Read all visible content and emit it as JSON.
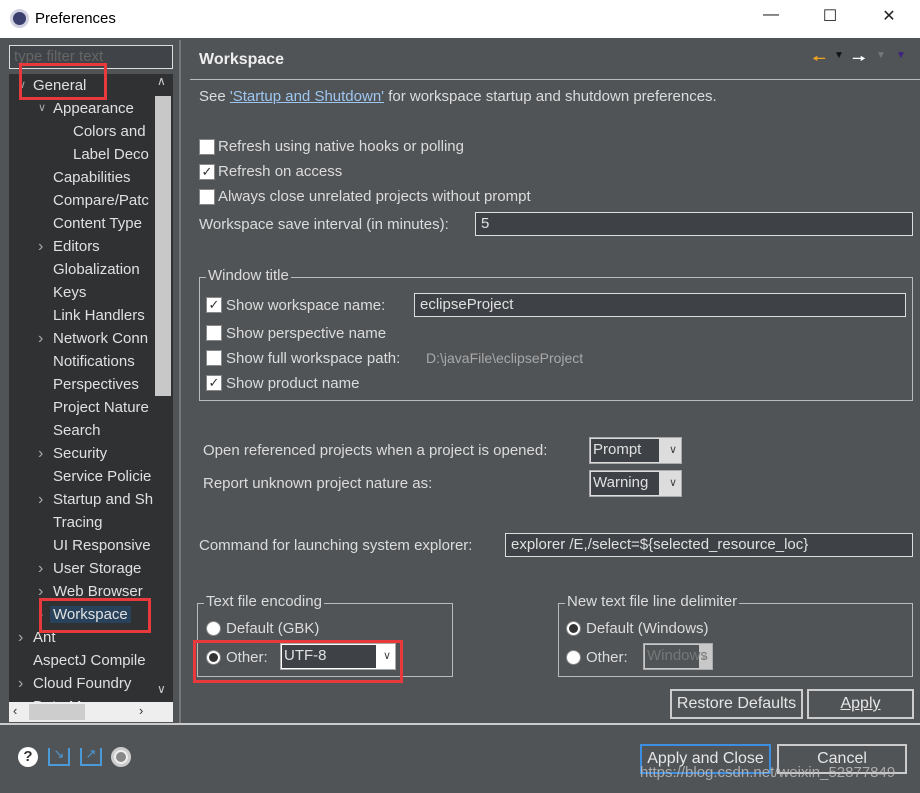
{
  "window": {
    "title": "Preferences",
    "icon": "eclipse-gear-icon",
    "controls": [
      "minimize",
      "maximize",
      "close"
    ]
  },
  "sidebar": {
    "filter_placeholder": "type filter text",
    "items": [
      {
        "label": "General",
        "level": 0,
        "expander": "expanded"
      },
      {
        "label": "Appearance",
        "level": 1,
        "expander": "expanded"
      },
      {
        "label": "Colors and",
        "level": 2
      },
      {
        "label": "Label Deco",
        "level": 2
      },
      {
        "label": "Capabilities",
        "level": 1
      },
      {
        "label": "Compare/Patc",
        "level": 1
      },
      {
        "label": "Content Type",
        "level": 1
      },
      {
        "label": "Editors",
        "level": 1,
        "expander": "collapsed"
      },
      {
        "label": "Globalization",
        "level": 1
      },
      {
        "label": "Keys",
        "level": 1
      },
      {
        "label": "Link Handlers",
        "level": 1
      },
      {
        "label": "Network Conn",
        "level": 1,
        "expander": "collapsed"
      },
      {
        "label": "Notifications",
        "level": 1
      },
      {
        "label": "Perspectives",
        "level": 1
      },
      {
        "label": "Project Nature",
        "level": 1
      },
      {
        "label": "Search",
        "level": 1
      },
      {
        "label": "Security",
        "level": 1,
        "expander": "collapsed"
      },
      {
        "label": "Service Policie",
        "level": 1
      },
      {
        "label": "Startup and Sh",
        "level": 1,
        "expander": "collapsed"
      },
      {
        "label": "Tracing",
        "level": 1
      },
      {
        "label": "UI Responsive",
        "level": 1
      },
      {
        "label": "User Storage",
        "level": 1,
        "expander": "collapsed"
      },
      {
        "label": "Web Browser",
        "level": 1,
        "expander": "collapsed"
      },
      {
        "label": "Workspace",
        "level": 1,
        "expander": "collapsed",
        "selected": true
      },
      {
        "label": "Ant",
        "level": 0,
        "expander": "collapsed"
      },
      {
        "label": "AspectJ Compile",
        "level": 0
      },
      {
        "label": "Cloud Foundry",
        "level": 0,
        "expander": "collapsed"
      },
      {
        "label": "Data M",
        "level": 0,
        "expander": "collapsed"
      }
    ]
  },
  "page": {
    "title": "Workspace",
    "nav_icons": [
      "back-arrow-icon",
      "back-menu-icon",
      "forward-arrow-icon",
      "forward-menu-icon",
      "view-menu-icon"
    ],
    "intro_pre": "See ",
    "intro_link": "'Startup and Shutdown'",
    "intro_post": " for workspace startup and shutdown preferences.",
    "checkboxes": [
      {
        "label": "Refresh using native hooks or polling",
        "checked": false
      },
      {
        "label": "Refresh on access",
        "checked": true
      },
      {
        "label": "Always close unrelated projects without prompt",
        "checked": false
      }
    ],
    "save_interval_label": "Workspace save interval (in minutes):",
    "save_interval_value": "5",
    "window_title": {
      "group_label": "Window title",
      "show_workspace_name": {
        "label": "Show workspace name:",
        "checked": true,
        "value": "eclipseProject"
      },
      "show_perspective_name": {
        "label": "Show perspective name",
        "checked": false
      },
      "show_full_path": {
        "label": "Show full workspace path:",
        "checked": false,
        "value": "D:\\javaFile\\eclipseProject"
      },
      "show_product_name": {
        "label": "Show product name",
        "checked": true
      }
    },
    "open_referenced_label": "Open referenced projects when a project is opened:",
    "open_referenced_value": "Prompt",
    "report_nature_label": "Report unknown project nature as:",
    "report_nature_value": "Warning",
    "explorer_label": "Command for launching system explorer:",
    "explorer_value": "explorer /E,/select=${selected_resource_loc}",
    "encoding": {
      "group_label": "Text file encoding",
      "default_label": "Default (GBK)",
      "other_label": "Other:",
      "other_value": "UTF-8",
      "selected": "other"
    },
    "delimiter": {
      "group_label": "New text file line delimiter",
      "default_label": "Default (Windows)",
      "other_label": "Other:",
      "other_value": "Windows",
      "selected": "default"
    },
    "restore_defaults": "Restore Defaults",
    "apply": "Apply"
  },
  "footer": {
    "icons": [
      "help-icon",
      "import-icon",
      "export-icon",
      "record-icon"
    ],
    "apply_close": "Apply and Close",
    "cancel": "Cancel"
  },
  "watermark": "https://blog.csdn.net/weixin_52877849",
  "colors": {
    "highlight": "#e8393d",
    "selection": "#29425b",
    "background": "#505457"
  }
}
